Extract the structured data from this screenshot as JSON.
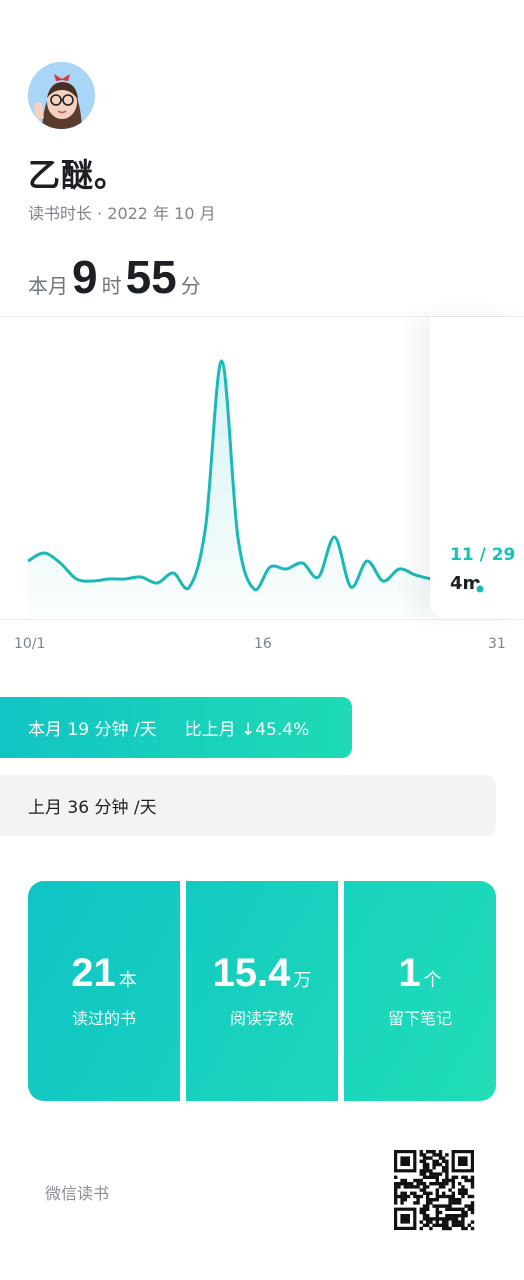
{
  "profile": {
    "name": "乙醚。",
    "subtitle": "读书时长 · 2022 年 10 月"
  },
  "total": {
    "prefix": "本月",
    "hours": "9",
    "hours_unit": "时",
    "minutes": "55",
    "minutes_unit": "分"
  },
  "chart_data": {
    "type": "line",
    "x": [
      1,
      2,
      3,
      4,
      5,
      6,
      7,
      8,
      9,
      10,
      11,
      12,
      13,
      14,
      15,
      16,
      17,
      18,
      19,
      20,
      21,
      22,
      23,
      24,
      25,
      26,
      27,
      28,
      29
    ],
    "values": [
      18,
      22,
      17,
      9,
      8,
      9,
      9,
      10,
      7,
      12,
      5,
      35,
      118,
      30,
      4,
      15,
      14,
      17,
      10,
      30,
      5,
      18,
      8,
      14,
      11,
      9,
      8,
      4,
      4
    ],
    "x_ticks": [
      "10/1",
      "16",
      "31"
    ],
    "fill": "gradient",
    "color": "#1ab8b8",
    "highlight": {
      "date": "11 / 29",
      "value": "4m"
    }
  },
  "compare": {
    "this_month": "本月 19 分钟 /天",
    "change": "比上月 ↓45.4%",
    "last_month": "上月 36 分钟 /天"
  },
  "stats": [
    {
      "num": "21",
      "unit": "本",
      "label": "读过的书"
    },
    {
      "num": "15.4",
      "unit": "万",
      "label": "阅读字数"
    },
    {
      "num": "1",
      "unit": "个",
      "label": "留下笔记"
    }
  ],
  "footer": {
    "brand": "微信读书"
  },
  "colors": {
    "accent": "#14c2bd",
    "accent_end": "#1ddbb4"
  }
}
